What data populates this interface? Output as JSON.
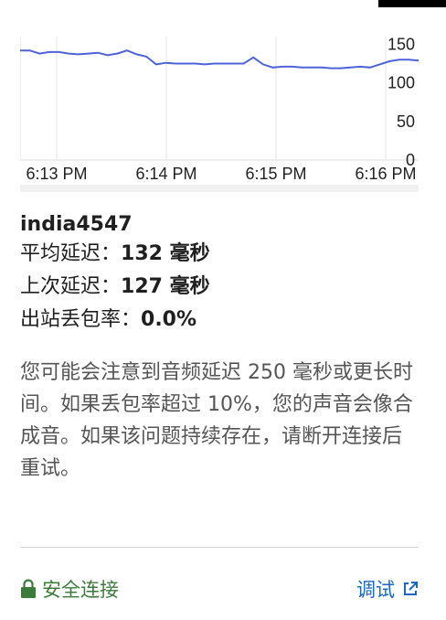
{
  "chart_data": {
    "type": "line",
    "x_ticks": [
      "6:13 PM",
      "6:14 PM",
      "6:15 PM",
      "6:16 PM"
    ],
    "y_ticks": [
      "150",
      "100",
      "50",
      "0"
    ],
    "ylim": [
      0,
      160
    ],
    "series": [
      {
        "color": "#4f63d8",
        "values": [
          142,
          142,
          138,
          140,
          140,
          138,
          137,
          138,
          139,
          136,
          138,
          142,
          137,
          134,
          124,
          126,
          125,
          125,
          125,
          124,
          125,
          125,
          125,
          125,
          133,
          124,
          120,
          121,
          121,
          120,
          120,
          120,
          119,
          119,
          120,
          121,
          120,
          124,
          128,
          130,
          130,
          129
        ]
      }
    ]
  },
  "stats": {
    "host": "india4547",
    "avg_label": "平均延迟：",
    "avg_value": "132 毫秒",
    "last_label": "上次延迟：",
    "last_value": "127 毫秒",
    "loss_label": "出站丢包率：",
    "loss_value": "0.0%"
  },
  "description": "您可能会注意到音频延迟 250 毫秒或更长时间。如果丢包率超过 10%，您的声音会像合成音。如果该问题持续存在，请断开连接后重试。",
  "footer": {
    "secure_label": "安全连接",
    "secure_color": "#3c7a3c",
    "debug_label": "调试",
    "debug_color": "#1a66c9",
    "secure_icon": "lock-icon",
    "debug_icon": "external-link-icon"
  }
}
